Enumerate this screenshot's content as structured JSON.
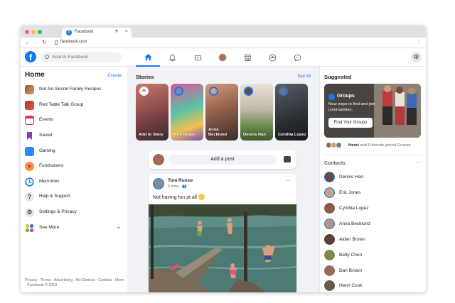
{
  "browser": {
    "tab_title": "Facebook",
    "url": "facebook.com"
  },
  "header": {
    "search_placeholder": "Search Facebook",
    "nav_icons": [
      "home-icon",
      "bell-icon",
      "watch-icon",
      "profile-avatar",
      "marketplace-icon",
      "groups-icon",
      "messenger-icon"
    ],
    "active_nav": "home-icon",
    "accent_color": "#1877f2"
  },
  "sidebar": {
    "title": "Home",
    "create_label": "Create",
    "items": [
      {
        "label": "Not-So-Secret Family Recipes",
        "icon": "group-photo-icon"
      },
      {
        "label": "Red Table Talk Group",
        "icon": "group-photo-icon"
      },
      {
        "label": "Events",
        "icon": "calendar-icon"
      },
      {
        "label": "Saved",
        "icon": "bookmark-icon"
      },
      {
        "label": "Gaming",
        "icon": "gaming-icon"
      },
      {
        "label": "Fundraisers",
        "icon": "heart-icon"
      },
      {
        "label": "Memories",
        "icon": "clock-icon"
      },
      {
        "label": "Help & Support",
        "icon": "question-icon"
      },
      {
        "label": "Settings & Privacy",
        "icon": "gear-icon"
      },
      {
        "label": "See More",
        "icon": "see-more-icon"
      }
    ],
    "footer": "Privacy · Terms · Advertising · Ad Choices · Cookies · More · Facebook © 2019"
  },
  "stories": {
    "title": "Stories",
    "see_all": "See All",
    "items": [
      {
        "name": "Add to Story"
      },
      {
        "name": "Tom Russo"
      },
      {
        "name": "Anna Becklund"
      },
      {
        "name": "Dennis Han"
      },
      {
        "name": "Cynthia Lopez"
      }
    ]
  },
  "composer": {
    "button_label": "Add a post"
  },
  "post": {
    "author": "Tom Russo",
    "time": "6 mins",
    "text": "Not having fun at all"
  },
  "suggested": {
    "title": "Suggested",
    "groups_card": {
      "name": "Groups",
      "description": "New ways to find and join communities.",
      "button": "Find Your Groups"
    },
    "joined_name": "Henri",
    "joined_rest": " and 9 friends joined Groups"
  },
  "contacts": {
    "title": "Contacts",
    "items": [
      "Dennis Han",
      "Eric Jones",
      "Cynthia Lopez",
      "Anna Becklund",
      "Aiden Brown",
      "Betty Chen",
      "Dan Brown",
      "Henri Cook"
    ]
  }
}
